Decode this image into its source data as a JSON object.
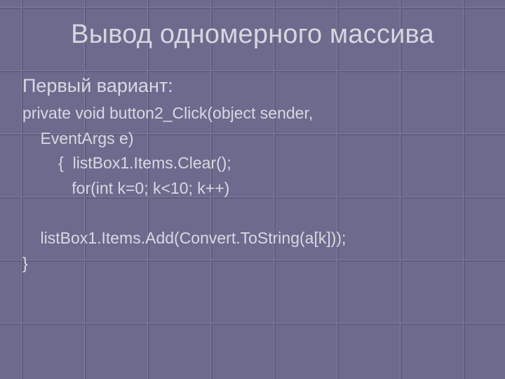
{
  "slide": {
    "title": "Вывод одномерного массива",
    "heading": "Первый вариант:",
    "code": {
      "l1a": "private void button2_Click(object sender,",
      "l1b": "    EventArgs e)",
      "l2": "        {  listBox1.Items.Clear();",
      "l3": "           for(int k=0; k<10; k++)",
      "l4": "                  ",
      "l5": "    listBox1.Items.Add(Convert.ToString(a[k]));",
      "l6": "}"
    }
  }
}
